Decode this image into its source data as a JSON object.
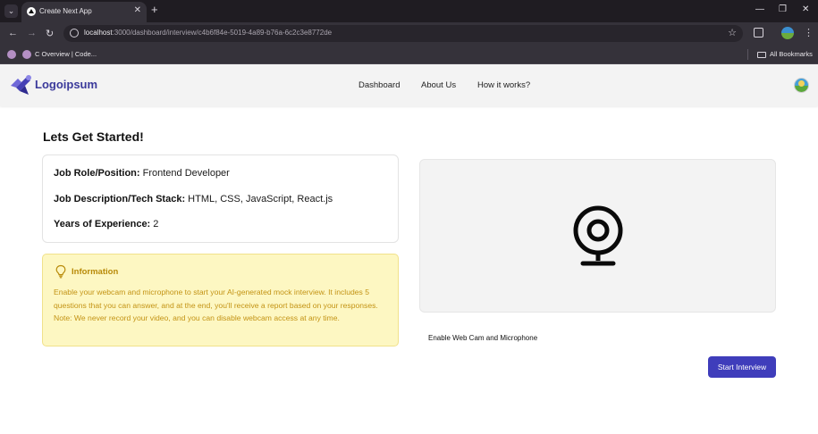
{
  "browser": {
    "tab_title": "Create Next App",
    "url_host": "localhost",
    "url_rest": ":3000/dashboard/interview/c4b6f84e-5019-4a89-b76a-6c2c3e8772de",
    "bookmark_label": "C Overview | Code...",
    "all_bookmarks_label": "All Bookmarks"
  },
  "header": {
    "logo_text": "Logoipsum",
    "nav": [
      "Dashboard",
      "About Us",
      "How it works?"
    ]
  },
  "page": {
    "title": "Lets Get Started!",
    "job": {
      "role_label": "Job Role/Position:",
      "role_value": " Frontend Developer",
      "desc_label": "Job Description/Tech Stack:",
      "desc_value": " HTML, CSS, JavaScript, React.js",
      "exp_label": "Years of Experience:",
      "exp_value": " 2"
    },
    "info": {
      "title": "Information",
      "text": "Enable your webcam and microphone to start your AI-generated mock interview. It includes 5 questions that you can answer, and at the end, you'll receive a report based on your responses. Note: We never record your video, and you can disable webcam access at any time."
    },
    "webcam_label": "Enable Web Cam and Microphone",
    "start_button": "Start Interview"
  },
  "colors": {
    "brand": "#3f3dbb",
    "info_bg": "#fdf7c2",
    "info_text": "#c39314"
  },
  "icons": [
    "tab-search-icon",
    "nextjs-favicon-icon",
    "close-icon",
    "plus-icon",
    "minimize-icon",
    "restore-icon",
    "back-icon",
    "forward-icon",
    "reload-icon",
    "site-info-icon",
    "star-icon",
    "extensions-icon",
    "profile-icon",
    "menu-icon",
    "folder-icon",
    "logo-icon",
    "lightbulb-icon",
    "webcam-icon"
  ]
}
